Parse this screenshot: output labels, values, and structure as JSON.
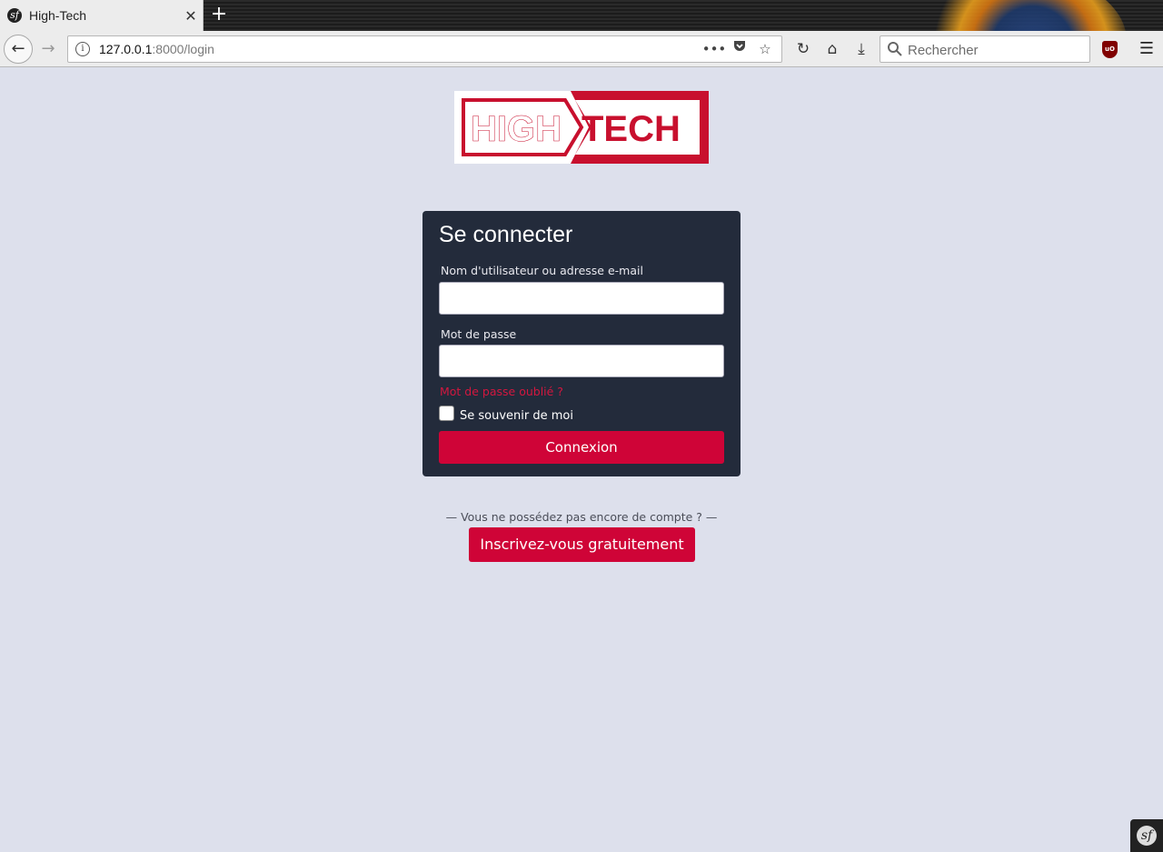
{
  "browser": {
    "tab_title": "High-Tech",
    "favicon_glyph": "sf",
    "close_glyph": "✕",
    "newtab_glyph": "+",
    "url_host": "127.0.0.1",
    "url_rest": ":8000/login",
    "search_placeholder": "Rechercher",
    "ublock_text": "uO",
    "icons": {
      "back": "arrow-left-icon",
      "forward": "arrow-right-icon",
      "info": "info-icon",
      "more": "ellipsis-icon",
      "pocket": "pocket-icon",
      "bookmark": "star-icon",
      "reload": "reload-icon",
      "home": "home-icon",
      "download": "download-icon",
      "search": "search-icon",
      "menu": "hamburger-menu-icon"
    }
  },
  "logo": {
    "part1": "HIGH",
    "part2": "TECH",
    "accent_color": "#c8102e"
  },
  "login": {
    "title": "Se connecter",
    "username_label": "Nom d'utilisateur ou adresse e-mail",
    "username_value": "",
    "password_label": "Mot de passe",
    "password_value": "",
    "forgot_link": "Mot de passe oublié ?",
    "remember_label": "Se souvenir de moi",
    "remember_checked": false,
    "submit_label": "Connexion"
  },
  "signup": {
    "prompt": "— Vous ne possédez pas encore de compte ? —",
    "button_label": "Inscrivez-vous gratuitement"
  },
  "colors": {
    "page_bg": "#dde0ec",
    "card_bg": "#232b3b",
    "primary": "#cf0437"
  },
  "symfony_toolbar": {
    "glyph": "sf"
  }
}
